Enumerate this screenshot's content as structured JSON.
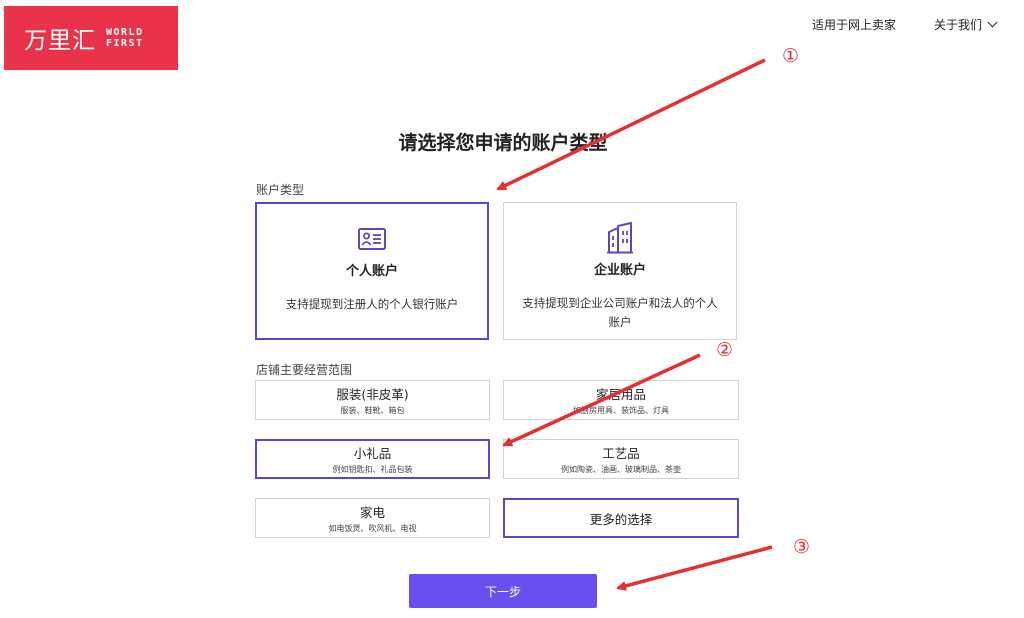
{
  "header": {
    "logo_cn": "万里汇",
    "logo_en_line1": "WORLD",
    "logo_en_line2": "FIRST",
    "nav": [
      "适用于网上卖家",
      "关于我们"
    ]
  },
  "main": {
    "title": "请选择您申请的账户类型",
    "account_section_label": "账户类型",
    "accounts": [
      {
        "name": "个人账户",
        "desc": "支持提现到注册人的个人银行账户",
        "icon": "id-card-icon",
        "selected": true
      },
      {
        "name": "企业账户",
        "desc": "支持提现到企业公司账户和法人的个人账户",
        "icon": "building-icon",
        "selected": false
      }
    ],
    "scope_section_label": "店铺主要经营范围",
    "categories": [
      {
        "name": "服装(非皮革)",
        "sub": "服装、鞋靴、箱包",
        "selected": false
      },
      {
        "name": "家居用品",
        "sub": "如厨房用具、装饰品、灯具",
        "selected": false
      },
      {
        "name": "小礼品",
        "sub": "例如钥匙扣、礼品包装",
        "selected": true
      },
      {
        "name": "工艺品",
        "sub": "例如陶瓷、油画、玻璃制品、茶壶",
        "selected": false
      },
      {
        "name": "家电",
        "sub": "如电饭煲、吹风机、电视",
        "selected": false
      },
      {
        "name": "更多的选择",
        "sub": "",
        "selected": true
      }
    ],
    "next_button": "下一步"
  },
  "annotations": [
    "①",
    "②",
    "③"
  ],
  "colors": {
    "brand": "#e8334a",
    "accent": "#5b47c4",
    "button": "#6a4ff0",
    "arrow": "#e53030"
  }
}
